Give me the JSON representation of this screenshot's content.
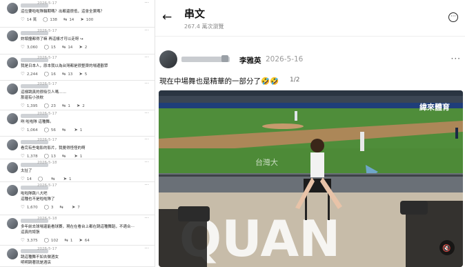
{
  "comments": [
    {
      "date": "2026-5-17",
      "lines": [
        "這位要啦啦隊輪期嗎？出都還很低，這會全黨嗎？"
      ],
      "stats": {
        "likes": "14 萬",
        "replies": "138",
        "reposts": "14",
        "shares": "100"
      }
    },
    {
      "date": "2026-5-17",
      "lines": [
        "妳頭撞都得了嘛 再這樣才可以走呀 ↪"
      ],
      "stats": {
        "likes": "3,060",
        "replies": "15",
        "reposts": "14",
        "shares": "2"
      }
    },
    {
      "date": "2026-5-17",
      "lines": [
        "我是日本人，原本我以為台灣都是很整齊的場邊觀眾"
      ],
      "stats": {
        "likes": "2,244",
        "replies": "16",
        "reposts": "13",
        "shares": "5"
      }
    },
    {
      "date": "2026-5-17",
      "lines": [
        "這樣跳真的很吸引人嗎……",
        "那還有小孩欸"
      ],
      "stats": {
        "likes": "1,395",
        "replies": "23",
        "reposts": "1",
        "shares": "2"
      }
    },
    {
      "date": "2026-5-17",
      "lines": [
        "咧 啦啦隊 這種舞。"
      ],
      "stats": {
        "likes": "1,064",
        "replies": "56",
        "reposts": "",
        "shares": "1"
      }
    },
    {
      "date": "2026-5-17",
      "lines": [
        "看完有些電影的影片，我覺得怪怪的啊"
      ],
      "stats": {
        "likes": "1,378",
        "replies": "13",
        "reposts": "",
        "shares": "1"
      }
    },
    {
      "date": "2026-5-18",
      "lines": [
        "太扯了"
      ],
      "stats": {
        "likes": "14",
        "replies": "",
        "reposts": "",
        "shares": "1"
      }
    },
    {
      "date": "2026-5-17",
      "lines": [
        "啦啦隊跳八大吧",
        "這種也不是啦啦隊了"
      ],
      "stats": {
        "likes": "1,670",
        "replies": "3",
        "reposts": "",
        "shares": "7"
      }
    },
    {
      "date": "2026-5-18",
      "lines": [
        "多年前去球場還能看球賽，現在在看台上都在跳這種舞蹈，不適合⋯",
        "這真的誇張"
      ],
      "stats": {
        "likes": "3,375",
        "replies": "102",
        "reposts": "1",
        "shares": "64"
      }
    },
    {
      "date": "2026-5-17",
      "lines": [
        "跳這種舞不如去做酒女",
        "明明跳著就是酒店"
      ],
      "stats": {
        "likes": "",
        "replies": "",
        "reposts": "",
        "shares": ""
      }
    }
  ],
  "thread": {
    "title": "串文",
    "views": "267.4 萬次瀏覽",
    "author": "李雅英",
    "date": "2026-5-16",
    "text": "現在中場舞也是精華的一部分了🤣🤣",
    "media_counter": "1/2"
  },
  "media": {
    "watermark": "緯來體育",
    "field_banner": "台灣大",
    "board_text": "QUAN"
  }
}
